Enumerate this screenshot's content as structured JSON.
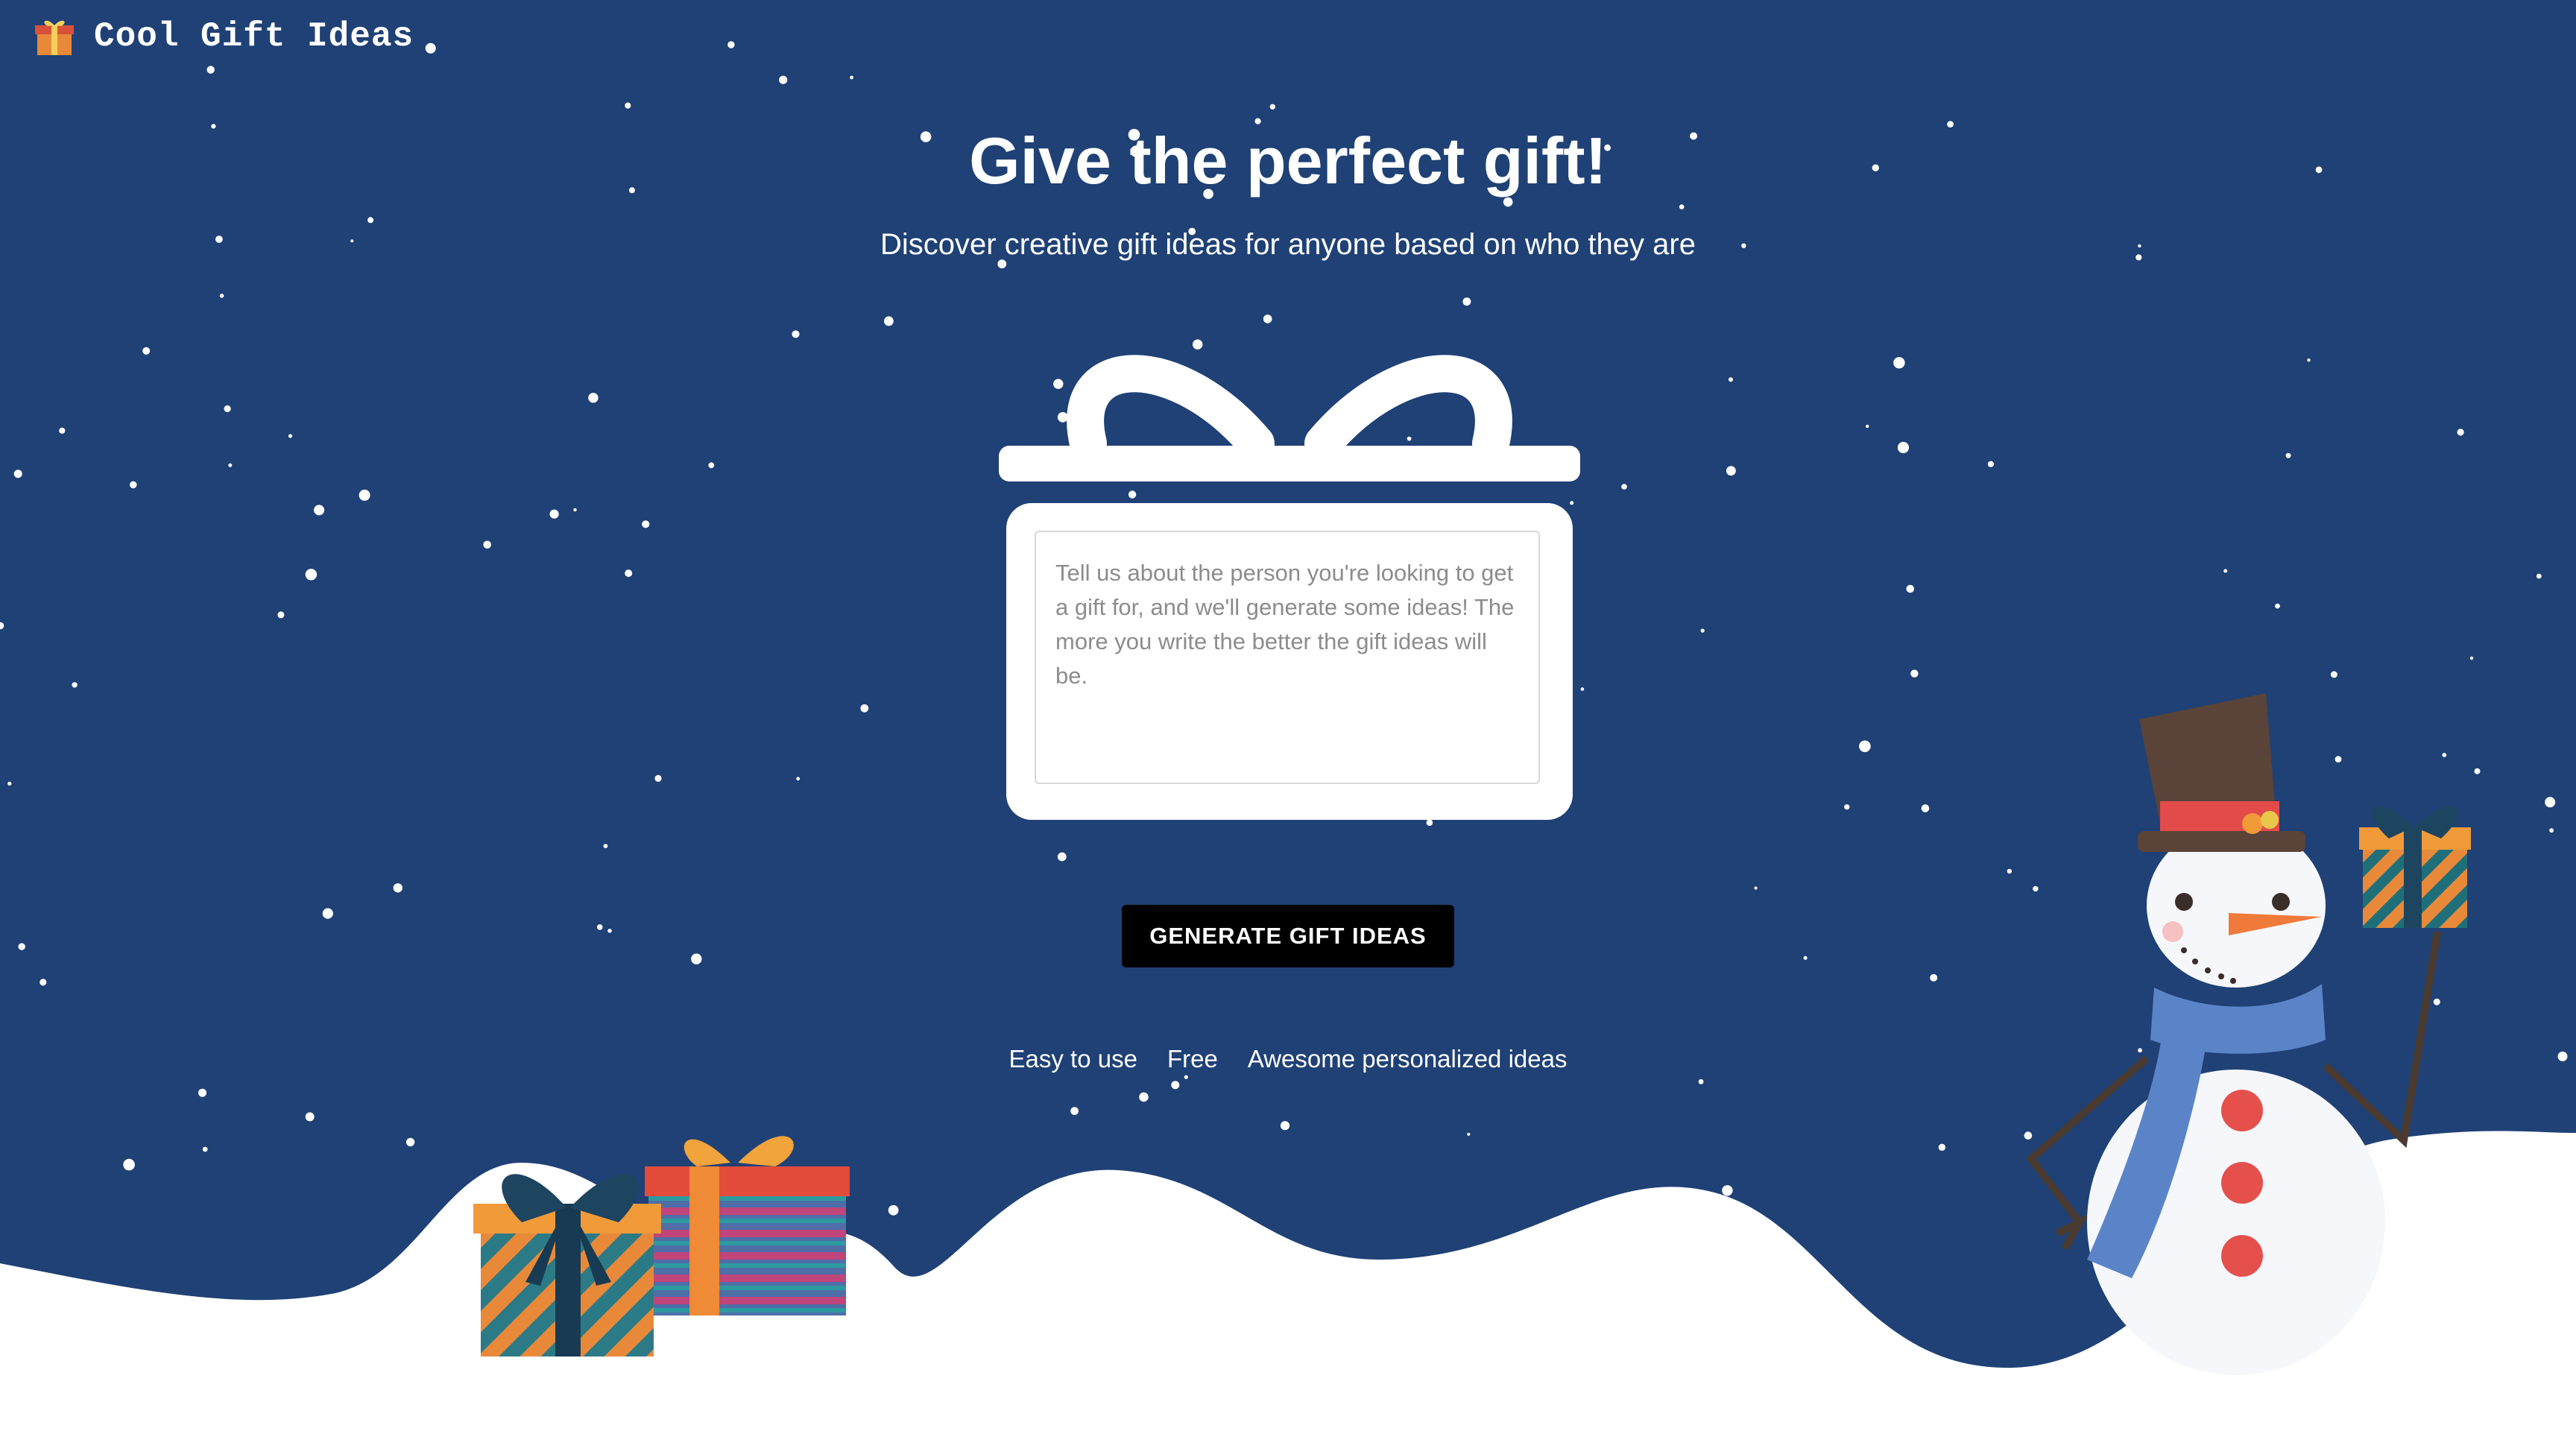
{
  "header": {
    "logo_icon": "wrapped-gift-emoji",
    "title": "Cool Gift Ideas"
  },
  "hero": {
    "headline": "Give the perfect gift!",
    "subheadline": "Discover creative gift ideas for anyone based on who they are"
  },
  "form": {
    "description_placeholder": "Tell us about the person you're looking to get a gift for, and we'll generate some ideas! The more you write the better the gift ideas will be.",
    "description_value": "",
    "submit_label": "GENERATE GIFT IDEAS"
  },
  "features": [
    "Easy to use",
    "Free",
    "Awesome personalized ideas"
  ],
  "colors": {
    "background": "#1f4175",
    "snow": "#ffffff",
    "button": "#000000",
    "button_text": "#ffffff"
  },
  "decorations": [
    "snow-ground",
    "snowflakes",
    "striped-gift-boxes-illustration",
    "snowman-illustration",
    "gift-box-outline"
  ]
}
